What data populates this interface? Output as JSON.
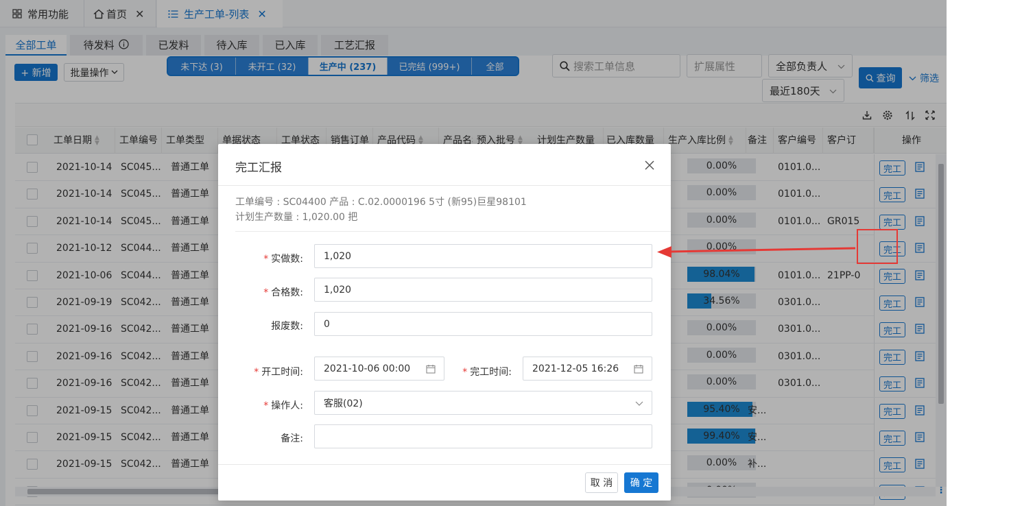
{
  "top_tabs": {
    "common": "常用功能",
    "home": "首页",
    "list": "生产工单-列表"
  },
  "sub_tabs": [
    "全部工单",
    "待发料",
    "已发料",
    "待入库",
    "已入库",
    "工艺汇报"
  ],
  "toolbar": {
    "new_label": "+ 新增",
    "batch_label": "批量操作",
    "segments": [
      "未下达 (3)",
      "未开工 (32)",
      "生产中 (237)",
      "已完结 (999+)",
      "全部"
    ],
    "search_placeholder": "搜索工单信息",
    "ext_placeholder": "扩展属性",
    "owner_value": "全部负责人",
    "range_value": "最近180天",
    "query_label": "查询",
    "filter_label": "筛选"
  },
  "table": {
    "headers": [
      "工单日期",
      "工单编号",
      "工单类型",
      "单据状态",
      "工单状态",
      "销售订单",
      "产品代码",
      "产品名称",
      "预入批号",
      "计划生产数量",
      "已入库数量",
      "生产入库比例",
      "备注",
      "客户编号",
      "客户订",
      "操作"
    ],
    "rows": [
      {
        "date": "2021-10-14",
        "no": "SC045...",
        "type": "普通工单",
        "ratio": "0.00%",
        "ratio_value": 0,
        "remark": "",
        "cust": "0101.0...",
        "order": ""
      },
      {
        "date": "2021-10-14",
        "no": "SC045...",
        "type": "普通工单",
        "ratio": "0.00%",
        "ratio_value": 0,
        "remark": "",
        "cust": "0101.0...",
        "order": ""
      },
      {
        "date": "2021-10-14",
        "no": "SC045...",
        "type": "普通工单",
        "ratio": "0.00%",
        "ratio_value": 0,
        "remark": "",
        "cust": "0101.0...",
        "order": "GR015"
      },
      {
        "date": "2021-10-12",
        "no": "SC044...",
        "type": "普通工单",
        "ratio": "0.00%",
        "ratio_value": 0,
        "remark": "",
        "cust": "",
        "order": ""
      },
      {
        "date": "2021-10-06",
        "no": "SC044...",
        "type": "普通工单",
        "ratio": "98.04%",
        "ratio_value": 98.04,
        "remark": "",
        "cust": "0101.0...",
        "order": "21PP-0"
      },
      {
        "date": "2021-09-19",
        "no": "SC042...",
        "type": "普通工单",
        "ratio": "34.56%",
        "ratio_value": 34.56,
        "remark": "",
        "cust": "0301.0...",
        "order": ""
      },
      {
        "date": "2021-09-16",
        "no": "SC042...",
        "type": "普通工单",
        "ratio": "0.00%",
        "ratio_value": 0,
        "remark": "",
        "cust": "0301.0...",
        "order": ""
      },
      {
        "date": "2021-09-16",
        "no": "SC042...",
        "type": "普通工单",
        "ratio": "0.00%",
        "ratio_value": 0,
        "remark": "",
        "cust": "0301.0...",
        "order": ""
      },
      {
        "date": "2021-09-16",
        "no": "SC042...",
        "type": "普通工单",
        "ratio": "0.00%",
        "ratio_value": 0,
        "remark": "",
        "cust": "0301.0...",
        "order": ""
      },
      {
        "date": "2021-09-15",
        "no": "SC042...",
        "type": "普通工单",
        "ratio": "95.40%",
        "ratio_value": 95.4,
        "remark": "安...",
        "cust": "",
        "order": ""
      },
      {
        "date": "2021-09-15",
        "no": "SC042...",
        "type": "普通工单",
        "ratio": "99.40%",
        "ratio_value": 99.4,
        "remark": "安...",
        "cust": "",
        "order": ""
      },
      {
        "date": "2021-09-15",
        "no": "SC042...",
        "type": "普通工单",
        "ratio": "0.00%",
        "ratio_value": 0,
        "remark": "补...",
        "cust": "",
        "order": ""
      },
      {
        "date": "",
        "no": "",
        "type": "",
        "ratio": "0.00%",
        "ratio_value": 0,
        "remark": "",
        "cust": "",
        "order": ""
      }
    ],
    "op_done_label": "完工"
  },
  "modal": {
    "title": "完工汇报",
    "info_line1": "工单编号 : SC04400      产品 : C.02.0000196 5寸 (新95)巨星98101",
    "info_line2": "计划生产数量 : 1,020.00 把",
    "fields": {
      "actual_label": "实做数:",
      "actual_value": "1,020",
      "qualified_label": "合格数:",
      "qualified_value": "1,020",
      "scrap_label": "报废数:",
      "scrap_value": "0",
      "start_label": "开工时间:",
      "start_value": "2021-10-06 00:00",
      "end_label": "完工时间:",
      "end_value": "2021-12-05 16:26",
      "operator_label": "操作人:",
      "operator_value": "客服(02)",
      "remark_label": "备注:",
      "remark_value": ""
    },
    "cancel_label": "取 消",
    "ok_label": "确 定"
  },
  "colors": {
    "primary": "#1677d2",
    "highlight": "#e53935",
    "progress": "#1e8bd4"
  }
}
